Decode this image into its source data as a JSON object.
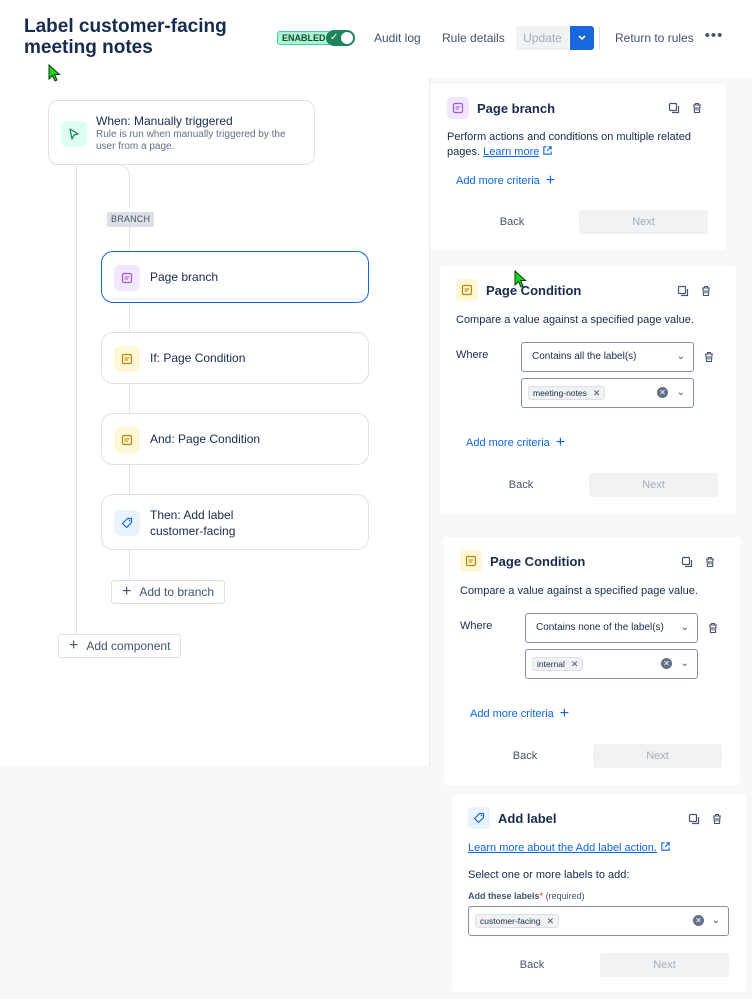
{
  "header": {
    "title": "Label customer-facing meeting notes",
    "status_badge": "ENABLED",
    "audit_log": "Audit log",
    "rule_details": "Rule details",
    "update": "Update",
    "return_to_rules": "Return to rules",
    "more_icon": "ellipsis-icon"
  },
  "flow": {
    "trigger": {
      "title": "When: Manually triggered",
      "description": "Rule is run when manually triggered by the user from a page."
    },
    "branch_tag": "BRANCH",
    "nodes": [
      {
        "label": "Page branch",
        "icon": "page-icon"
      },
      {
        "label": "If: Page Condition",
        "icon": "page-icon"
      },
      {
        "label": "And: Page Condition",
        "icon": "page-icon"
      },
      {
        "label_line1": "Then: Add label",
        "label_line2": "customer-facing",
        "icon": "tag-icon"
      }
    ],
    "add_to_branch": "Add to branch",
    "add_component": "Add component"
  },
  "page_branch_panel": {
    "title": "Page branch",
    "description": "Perform actions and conditions on multiple related pages.",
    "learn_more": "Learn more",
    "add_more_criteria": "Add more criteria",
    "back": "Back",
    "next": "Next"
  },
  "condition_panel_1": {
    "title": "Page Condition",
    "description": "Compare a value against a specified page value.",
    "where": "Where",
    "operator": "Contains all the label(s)",
    "labels": [
      "meeting-notes"
    ],
    "add_more_criteria": "Add more criteria",
    "back": "Back",
    "next": "Next"
  },
  "condition_panel_2": {
    "title": "Page Condition",
    "description": "Compare a value against a specified page value.",
    "where": "Where",
    "operator": "Contains none of the label(s)",
    "labels": [
      "internal"
    ],
    "add_more_criteria": "Add more criteria",
    "back": "Back",
    "next": "Next"
  },
  "add_label_panel": {
    "title": "Add label",
    "learn_more": "Learn more about the Add label action.",
    "instruction": "Select one or more labels to add:",
    "field_label": "Add these labels",
    "required_marker": "*",
    "required_text": "(required)",
    "labels": [
      "customer-facing"
    ],
    "back": "Back",
    "next": "Next"
  },
  "colors": {
    "accent": "#1868db",
    "enabled_green": "#1f845a",
    "link": "#0c66e4",
    "cursor": "#1fd21f"
  }
}
